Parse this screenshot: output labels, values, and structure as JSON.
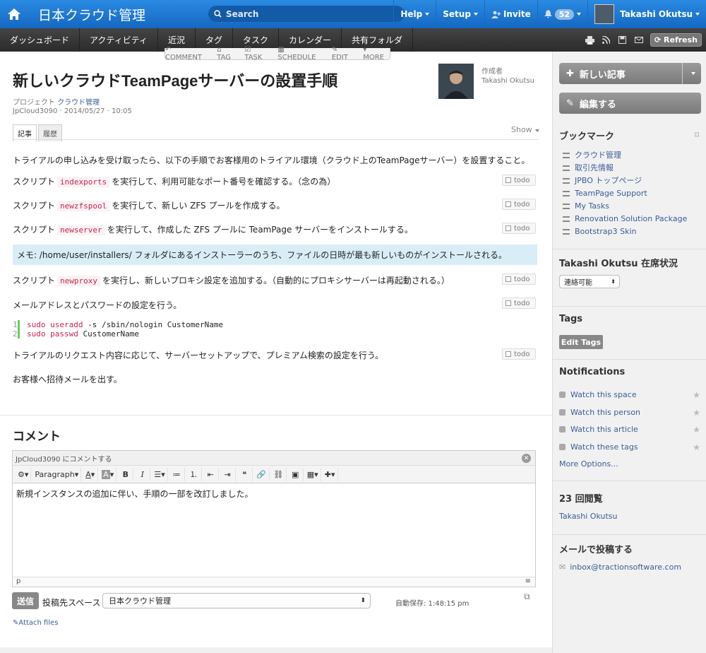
{
  "app": {
    "title": "日本クラウド管理",
    "search_placeholder": "Search"
  },
  "topnav": {
    "help": "Help",
    "setup": "Setup",
    "invite": "Invite",
    "notifications_count": "52",
    "user_name": "Takashi Okutsu"
  },
  "navbar": {
    "items": [
      "ダッシュボード",
      "アクティビティ",
      "近況",
      "タグ",
      "タスク",
      "カレンダー",
      "共有フォルダ"
    ],
    "refresh": "Refresh"
  },
  "actionbar": {
    "items": [
      "COMMENT",
      "TAG",
      "TASK",
      "SCHEDULE",
      "EDIT",
      "MORE"
    ]
  },
  "article": {
    "title": "新しいクラウドTeamPageサーバーの設置手順",
    "project_label": "プロジェクト",
    "project_link": "クラウド管理",
    "meta": "JpCloud3090 · 2014/05/27 · 10:05",
    "author_label": "作成者",
    "author_name": "Takashi Okutsu",
    "tabs": [
      "記事",
      "履歴"
    ],
    "show": "Show",
    "intro": "トライアルの申し込みを受け取ったら、以下の手順でお客様用のトライアル環境（クラウド上のTeamPageサーバー）を設置すること。",
    "todo_label": "todo",
    "step1": {
      "pre": "スクリプト",
      "code": "indexports",
      "post": "を実行して、利用可能なポート番号を確認する。（念の為）"
    },
    "step2": {
      "pre": "スクリプト",
      "code": "newzfspool",
      "post": "を実行して、新しい ZFS プールを作成する。"
    },
    "step3": {
      "pre": "スクリプト",
      "code": "newserver",
      "post": "を実行して、作成した ZFS プールに TeamPage サーバーをインストールする。"
    },
    "memo": "メモ: /home/user/installers/ フォルダにあるインストーラーのうち、ファイルの日時が最も新しいものがインストールされる。",
    "step4": {
      "pre": "スクリプト",
      "code": "newproxy",
      "post": "を実行し、新しいプロキシ設定を追加する。（自動的にプロキシサーバーは再起動される。）"
    },
    "step5": "メールアドレスとパスワードの設定を行う。",
    "code_lines": [
      {
        "num": "1",
        "sudo": "sudo",
        "cmd": "useradd",
        "rest": " -s /sbin/nologin CustomerName"
      },
      {
        "num": "2",
        "sudo": "sudo",
        "cmd": "passwd",
        "rest": " CustomerName"
      }
    ],
    "step6": "トライアルのリクエスト内容に応じて、サーバーセットアップで、プレミアム検索の設定を行う。",
    "step7": "お客様へ招待メールを出す。"
  },
  "comment": {
    "heading": "コメント",
    "editor_header": "JpCloud3090 にコメントする",
    "paragraph_select": "Paragraph",
    "text": "新規インスタンスの追加に伴い、手順の一部を改訂しました。",
    "path": "p",
    "submit": "送信",
    "post_space_label": "投稿先スペース",
    "post_space_value": "日本クラウド管理",
    "autosave": "自動保存: 1:48:15 pm",
    "attach": "Attach files"
  },
  "sidebar": {
    "new_article": "新しい記事",
    "edit": "編集する",
    "bookmarks_title": "ブックマーク",
    "bookmarks": [
      "クラウド管理",
      "取引先情報",
      "JPBO トップページ",
      "TeamPage Support",
      "My Tasks",
      "Renovation Solution Package",
      "Bootstrap3 Skin"
    ],
    "presence_title": "Takashi Okutsu 在席状況",
    "presence_value": "連絡可能",
    "tags_title": "Tags",
    "edit_tags": "Edit Tags",
    "notifications_title": "Notifications",
    "notifications": [
      "Watch this space",
      "Watch this person",
      "Watch this article",
      "Watch these tags"
    ],
    "more_options": "More Options...",
    "views_title": "23 回閲覧",
    "views_user": "Takashi Okutsu",
    "mail_title": "メールで投稿する",
    "mail_address": "inbox@tractionsoftware.com"
  }
}
